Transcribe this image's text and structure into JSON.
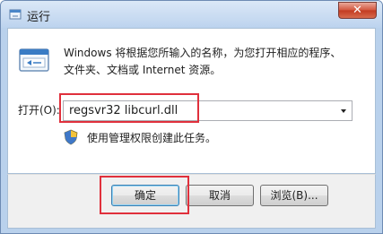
{
  "window": {
    "title": "运行",
    "close_glyph": "✕"
  },
  "icons": {
    "title": "run-icon",
    "main": "run-program-icon",
    "shield": "uac-shield-icon",
    "dropdown": "chevron-down-icon"
  },
  "description": {
    "line1": "Windows 将根据您所输入的名称，为您打开相应的程序、",
    "line2": "文件夹、文档或 Internet 资源。"
  },
  "open_field": {
    "label": "打开(O):",
    "value": "regsvr32 libcurl.dll"
  },
  "admin_note": "使用管理权限创建此任务。",
  "buttons": {
    "ok": "确定",
    "cancel": "取消",
    "browse": "浏览(B)..."
  },
  "colors": {
    "highlight": "#e0303c",
    "title_bar": "#bcd3ee",
    "close_button": "#c23a20"
  }
}
